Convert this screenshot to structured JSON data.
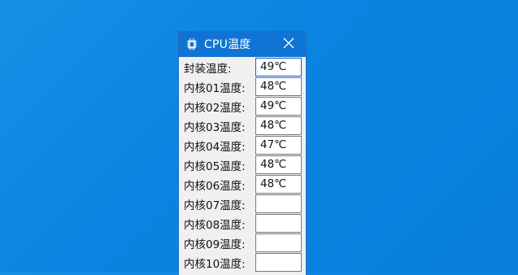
{
  "window": {
    "title": "CPU温度",
    "icon": "cpu-gear-icon",
    "close_icon": "close-icon"
  },
  "rows": [
    {
      "label": "封装温度:",
      "value": "49℃"
    },
    {
      "label": "内核01温度:",
      "value": "48℃"
    },
    {
      "label": "内核02温度:",
      "value": "49℃"
    },
    {
      "label": "内核03温度:",
      "value": "48℃"
    },
    {
      "label": "内核04温度:",
      "value": "47℃"
    },
    {
      "label": "内核05温度:",
      "value": "48℃"
    },
    {
      "label": "内核06温度:",
      "value": "48℃"
    },
    {
      "label": "内核07温度:",
      "value": ""
    },
    {
      "label": "内核08温度:",
      "value": ""
    },
    {
      "label": "内核09温度:",
      "value": ""
    },
    {
      "label": "内核10温度:",
      "value": ""
    }
  ],
  "colors": {
    "desktop": "#0a84e0",
    "titlebar": "#0f74d4"
  }
}
